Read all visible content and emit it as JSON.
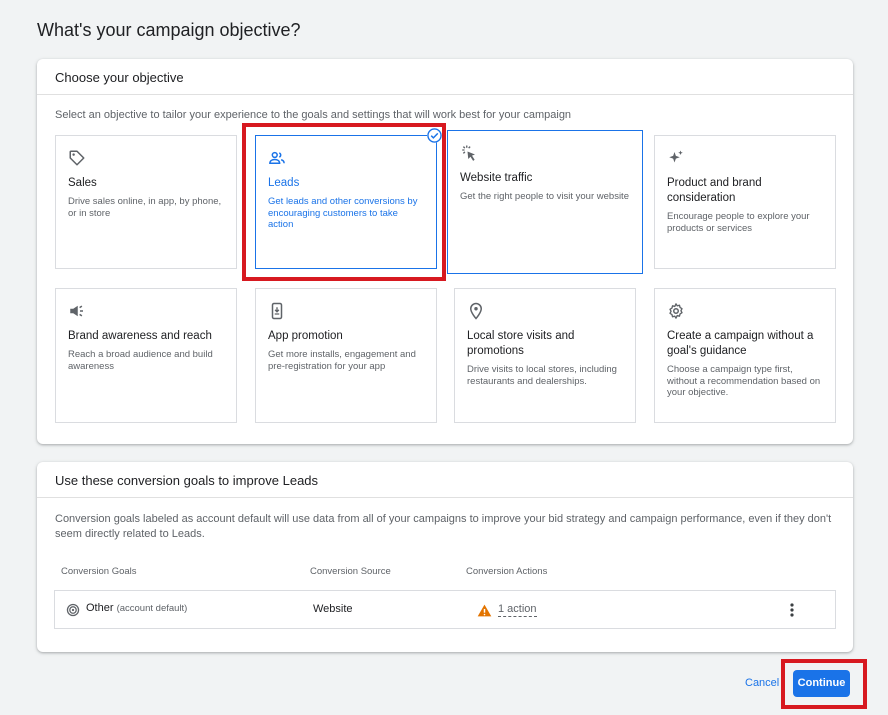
{
  "page": {
    "title": "What's your campaign objective?"
  },
  "objective_card": {
    "header": "Choose your objective",
    "intro": "Select an objective to tailor your experience to the goals and settings that will work best for your campaign",
    "tiles": [
      {
        "title": "Sales",
        "desc": "Drive sales online, in app, by phone, or in store",
        "icon": "tag-icon"
      },
      {
        "title": "Leads",
        "desc": "Get leads and other conversions by encouraging customers to take action",
        "icon": "people-icon"
      },
      {
        "title": "Website traffic",
        "desc": "Get the right people to visit your website",
        "icon": "cursor-click-icon"
      },
      {
        "title": "Product and brand consideration",
        "desc": "Encourage people to explore your products or services",
        "icon": "sparkle-icon"
      },
      {
        "title": "Brand awareness and reach",
        "desc": "Reach a broad audience and build awareness",
        "icon": "megaphone-icon"
      },
      {
        "title": "App promotion",
        "desc": "Get more installs, engagement and pre-registration for your app",
        "icon": "phone-download-icon"
      },
      {
        "title": "Local store visits and promotions",
        "desc": "Drive visits to local stores, including restaurants and dealerships.",
        "icon": "location-pin-icon"
      },
      {
        "title": "Create a campaign without a goal's guidance",
        "desc": "Choose a campaign type first, without a recommendation based on your objective.",
        "icon": "gear-icon"
      }
    ]
  },
  "goals_card": {
    "header": "Use these conversion goals to improve Leads",
    "desc": "Conversion goals labeled as account default will use data from all of your campaigns to improve your bid strategy and campaign performance, even if they don't seem directly related to Leads.",
    "columns": [
      "Conversion Goals",
      "Conversion Source",
      "Conversion Actions"
    ],
    "row": {
      "goal": "Other",
      "goal_tag": "(account default)",
      "source": "Website",
      "actions": "1 action"
    }
  },
  "footer": {
    "cancel": "Cancel",
    "continue": "Continue"
  },
  "colors": {
    "accent": "#1a73e8",
    "highlight": "#d71920",
    "warning": "#e37400"
  }
}
